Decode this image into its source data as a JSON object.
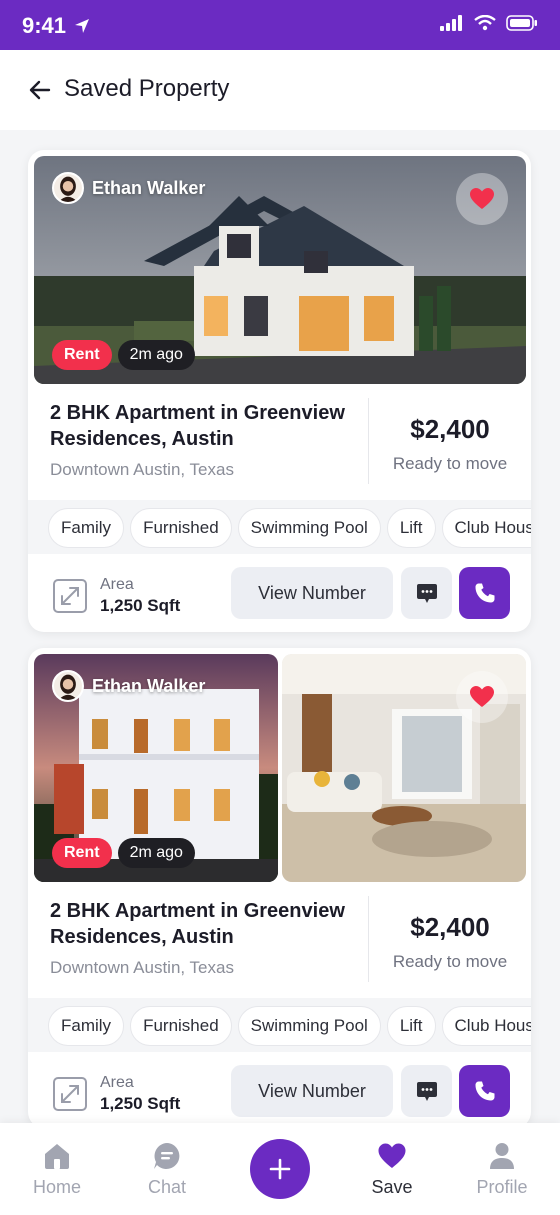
{
  "status_bar": {
    "time": "9:41"
  },
  "header": {
    "title": "Saved Property",
    "back_icon": "arrow-left-icon"
  },
  "listings": [
    {
      "agent_name": "Ethan Walker",
      "badge": "Rent",
      "posted": "2m ago",
      "title": "2 BHK Apartment in Greenview Residences, Austin",
      "location": "Downtown Austin, Texas",
      "price": "$2,400",
      "availability": "Ready to move",
      "tags": [
        "Family",
        "Furnished",
        "Swimming Pool",
        "Lift",
        "Club House"
      ],
      "area_label": "Area",
      "area_value": "1,250 Sqft",
      "view_button": "View Number"
    },
    {
      "agent_name": "Ethan Walker",
      "badge": "Rent",
      "posted": "2m ago",
      "title": "2 BHK Apartment in Greenview Residences, Austin",
      "location": "Downtown Austin, Texas",
      "price": "$2,400",
      "availability": "Ready to move",
      "tags": [
        "Family",
        "Furnished",
        "Swimming Pool",
        "Lift",
        "Club House"
      ],
      "area_label": "Area",
      "area_value": "1,250 Sqft",
      "view_button": "View Number"
    }
  ],
  "bottom_nav": {
    "items": [
      {
        "label": "Home",
        "icon": "home-icon"
      },
      {
        "label": "Chat",
        "icon": "chat-icon"
      },
      {
        "label": "Save",
        "icon": "heart-icon"
      },
      {
        "label": "Profile",
        "icon": "profile-icon"
      }
    ],
    "active": "Save",
    "add_icon": "plus-icon"
  },
  "colors": {
    "brand": "#6b2bc2",
    "rent_badge": "#f2304c",
    "favorite": "#f2304c"
  }
}
